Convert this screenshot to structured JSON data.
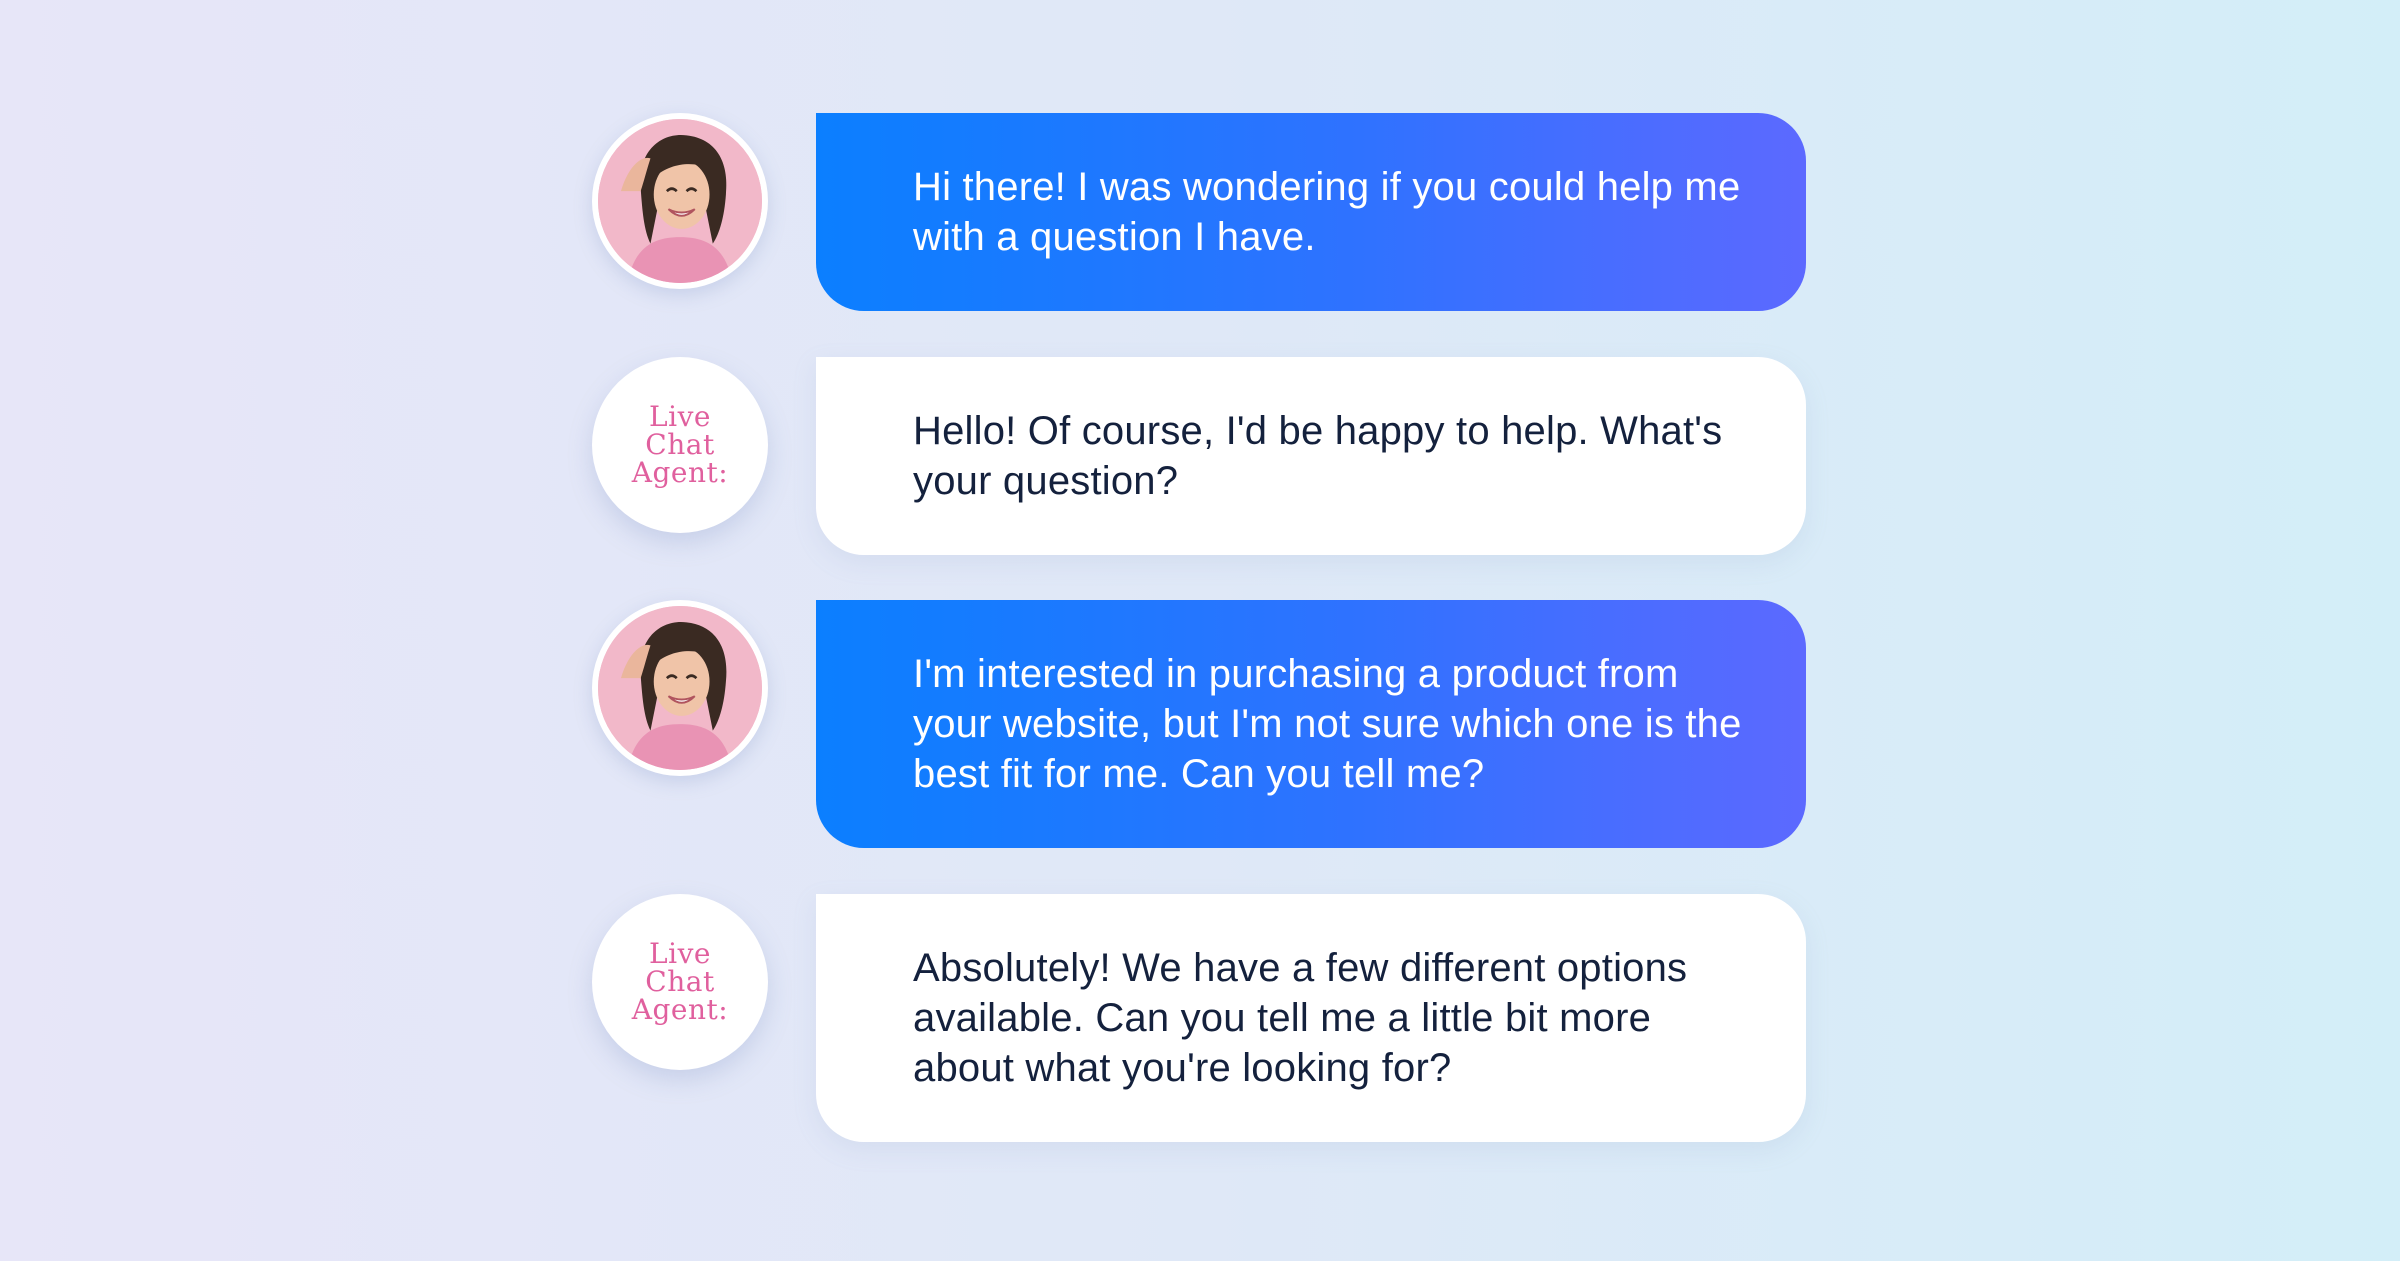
{
  "conversation": {
    "messages": [
      {
        "sender": "user",
        "text": "Hi there! I was wondering if you could help me with a question I have."
      },
      {
        "sender": "agent",
        "avatar_label": [
          "Live",
          "Chat",
          "Agent:"
        ],
        "text": "Hello! Of course, I'd be happy to help. What's your question?"
      },
      {
        "sender": "user",
        "text": "I'm interested in purchasing a product from your website, but I'm not sure which one is the best fit for me. Can you tell me?"
      },
      {
        "sender": "agent",
        "avatar_label": [
          "Live",
          "Chat",
          "Agent:"
        ],
        "text": "Absolutely! We have a few different options available. Can you tell me a little bit more about what you're looking for?"
      }
    ]
  },
  "colors": {
    "user_bubble_start": "#0b7fff",
    "user_bubble_end": "#5c69ff",
    "agent_bubble": "#ffffff",
    "agent_text": "#14213d",
    "agent_label": "#e0609e"
  },
  "icons": {
    "user_avatar": "woman-photo-avatar"
  }
}
